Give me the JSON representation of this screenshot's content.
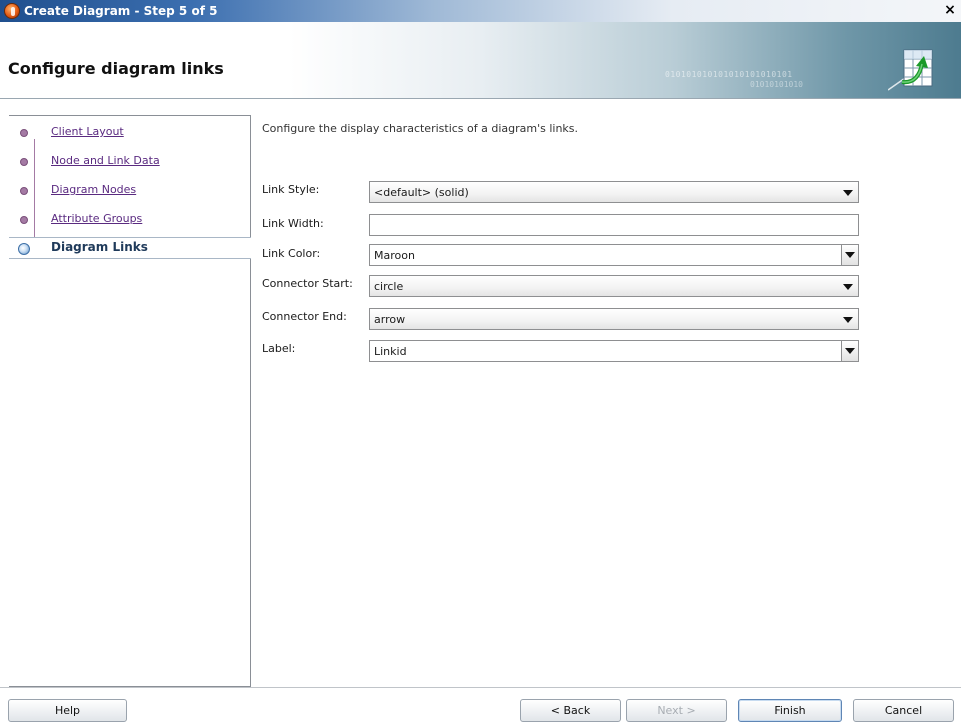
{
  "window": {
    "title": "Create Diagram - Step 5 of 5",
    "close_glyph": "×"
  },
  "header": {
    "title": "Configure diagram links",
    "binary_1": "010101010101010101010101",
    "binary_2": "01010101010"
  },
  "nav": {
    "items": [
      {
        "label": "Client Layout"
      },
      {
        "label": "Node and Link Data"
      },
      {
        "label": "Diagram Nodes"
      },
      {
        "label": "Attribute Groups"
      },
      {
        "label": "Diagram Links",
        "active": true
      }
    ]
  },
  "main": {
    "description": "Configure the display characteristics of a diagram's links.",
    "fields": [
      {
        "label": "Link Style:",
        "value": "<default> (solid)",
        "kind": "dropdown"
      },
      {
        "label": "Link Width:",
        "value": "",
        "kind": "text"
      },
      {
        "label": "Link Color:",
        "value": "Maroon",
        "kind": "combo"
      },
      {
        "label": "Connector Start:",
        "value": "circle",
        "kind": "dropdown"
      },
      {
        "label": "Connector End:",
        "value": "arrow",
        "kind": "dropdown"
      },
      {
        "label": "Label:",
        "value": "Linkid",
        "kind": "combo"
      }
    ]
  },
  "footer": {
    "help": "Help",
    "back": "< Back",
    "next": "Next >",
    "finish": "Finish",
    "cancel": "Cancel"
  },
  "icons": {
    "app": "oracle-app-icon",
    "close": "close-icon",
    "wizard": "diagram-wizard-icon"
  },
  "colors": {
    "link_visited": "#5a2a80",
    "accent_blue": "#3d6fa6"
  }
}
